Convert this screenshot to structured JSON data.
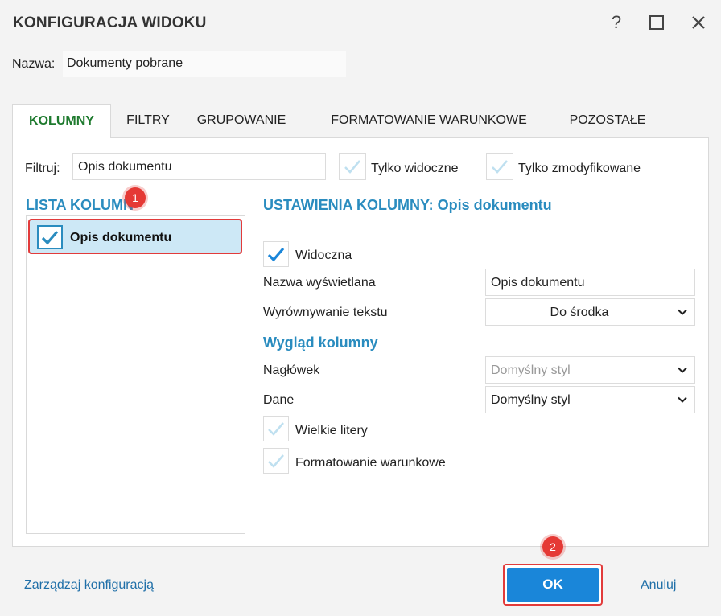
{
  "window": {
    "title": "KONFIGURACJA WIDOKU"
  },
  "name": {
    "label": "Nazwa:",
    "value": "Dokumenty pobrane"
  },
  "tabs": [
    {
      "label": "KOLUMNY",
      "active": true
    },
    {
      "label": "FILTRY"
    },
    {
      "label": "GRUPOWANIE"
    },
    {
      "label": "FORMATOWANIE WARUNKOWE"
    },
    {
      "label": "POZOSTAŁE"
    }
  ],
  "filter": {
    "label": "Filtruj:",
    "value": "Opis dokumentu",
    "only_visible": "Tylko widoczne",
    "only_modified": "Tylko zmodyfikowane"
  },
  "column_list": {
    "title": "LISTA KOLUMN",
    "items": [
      {
        "label": "Opis dokumentu",
        "checked": true
      }
    ]
  },
  "column_settings": {
    "title": "USTAWIENIA KOLUMNY: Opis dokumentu",
    "visible_label": "Widoczna",
    "display_name_label": "Nazwa wyświetlana",
    "display_name_value": "Opis dokumentu",
    "alignment_label": "Wyrównywanie tekstu",
    "alignment_value": "Do środka",
    "appearance_title": "Wygląd kolumny",
    "header_label": "Nagłówek",
    "header_value": "Domyślny styl",
    "data_label": "Dane",
    "data_value": "Domyślny styl",
    "uppercase_label": "Wielkie litery",
    "conditional_label": "Formatowanie warunkowe"
  },
  "badges": {
    "first": "1",
    "second": "2"
  },
  "footer": {
    "manage_link": "Zarządzaj konfiguracją",
    "ok": "OK",
    "cancel": "Anuluj"
  },
  "colors": {
    "accent": "#2a8cbf",
    "active_tab": "#1e7a2e",
    "ok_button": "#1a86d9",
    "highlight_border": "#e23b3b",
    "badge": "#e53935"
  }
}
